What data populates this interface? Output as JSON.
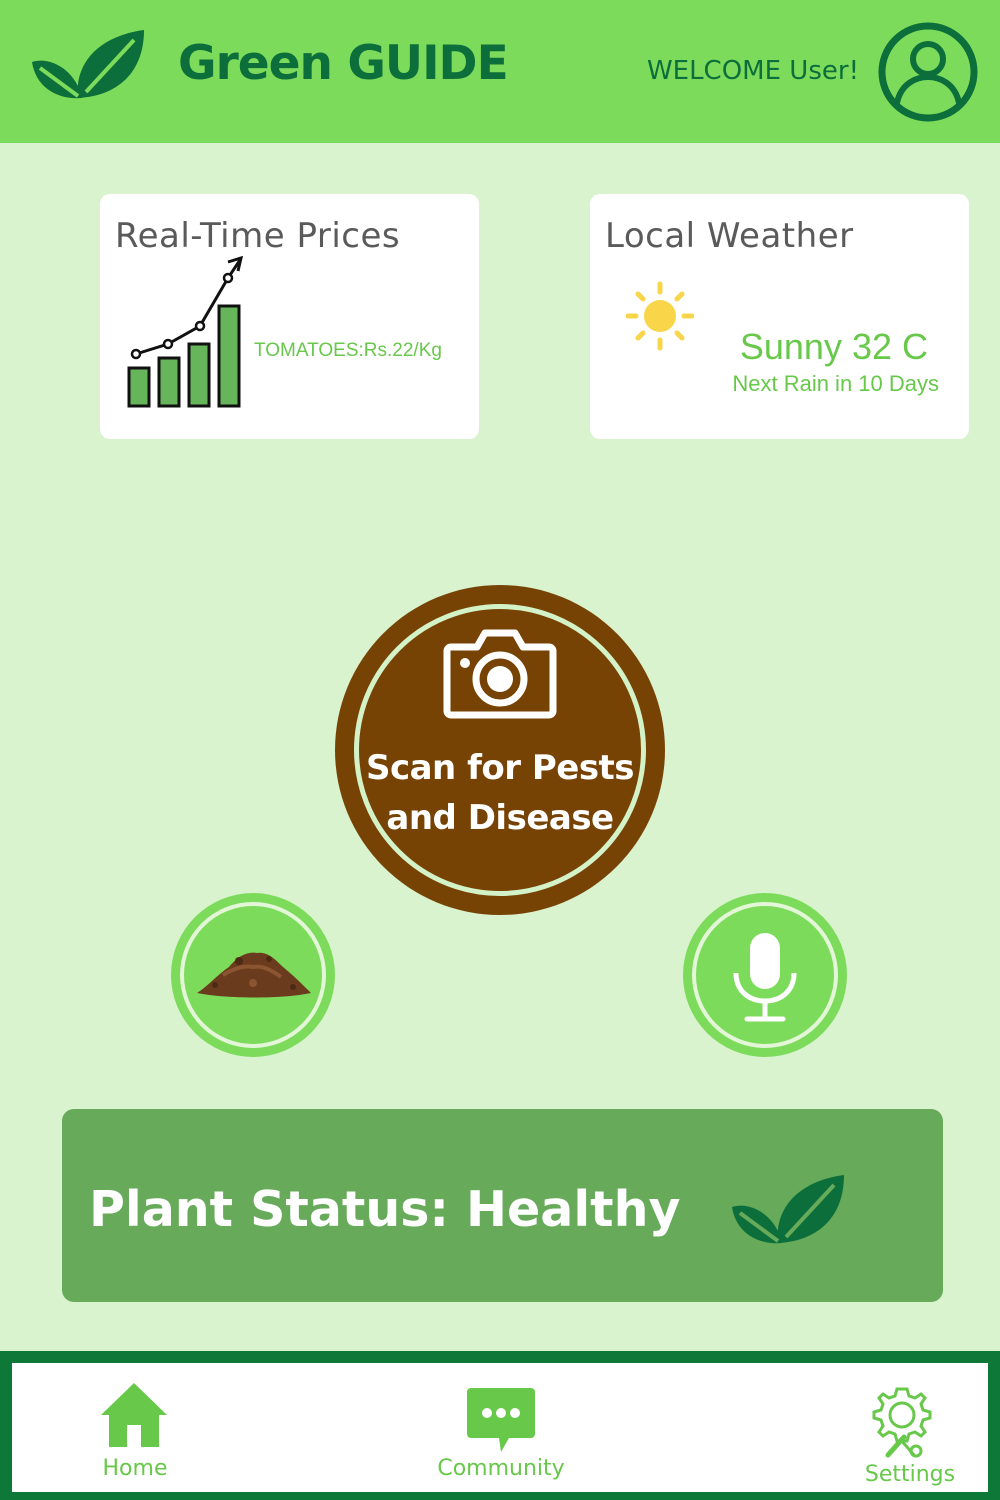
{
  "header": {
    "app_title": "Green GUIDE",
    "welcome_text": "WELCOME User!",
    "logo_icon": "leaves-icon",
    "avatar_icon": "user-avatar-icon"
  },
  "prices_card": {
    "title": "Real-Time Prices",
    "price_text": "TOMATOES:Rs.22/Kg",
    "icon": "growth-chart-icon"
  },
  "weather_card": {
    "title": "Local Weather",
    "condition": "Sunny 32 C",
    "forecast": "Next Rain in 10 Days",
    "icon": "sun-icon"
  },
  "scan_button": {
    "label": "Scan for Pests\nand Disease",
    "icon": "camera-icon"
  },
  "soil_button": {
    "icon": "soil-icon"
  },
  "voice_button": {
    "icon": "microphone-icon"
  },
  "status": {
    "text": "Plant Status: Healthy",
    "icon": "leaves-icon"
  },
  "bottom_nav": {
    "items": [
      {
        "label": "Home",
        "icon": "home-icon"
      },
      {
        "label": "Community",
        "icon": "chat-icon"
      },
      {
        "label": "Settings",
        "icon": "gear-icon"
      }
    ]
  },
  "colors": {
    "header_bg": "#7ddb5b",
    "page_bg": "#d9f3cf",
    "brand_dark_green": "#0c6e3a",
    "accent_green": "#67c84a",
    "scan_brown": "#774304",
    "status_panel": "#66aa5a",
    "nav_border": "#0d7837"
  }
}
